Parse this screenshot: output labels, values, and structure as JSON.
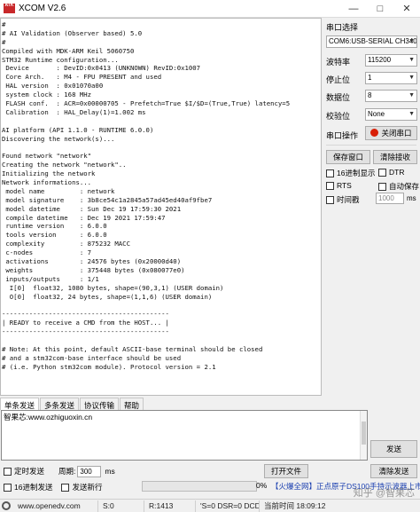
{
  "window": {
    "title": "XCOM V2.6",
    "app_icon_text": "ATK\nXCOM"
  },
  "terminal": {
    "lines": [
      "#",
      "# AI Validation (Observer based) 5.0",
      "#",
      "Compiled with MDK-ARM Keil 5060750",
      "STM32 Runtime configuration...",
      " Device       : DevID:0x0413 (UNKNOWN) RevID:0x1007",
      " Core Arch.   : M4 - FPU PRESENT and used",
      " HAL version  : 0x01070a00",
      " system clock : 168 MHz",
      " FLASH conf.  : ACR=0x00000705 - Prefetch=True $I/$D=(True,True) latency=5",
      " Calibration  : HAL_Delay(1)=1.002 ms",
      "",
      "AI platform (API 1.1.0 - RUNTIME 6.0.0)",
      "Discovering the network(s)...",
      "",
      "Found network \"network\"",
      "Creating the network \"network\"..",
      "Initializing the network",
      "Network informations...",
      " model name         : network",
      " model signature    : 3b8ce54c1a2845a57ad45ed40af9fbe7",
      " model datetime     : Sun Dec 19 17:59:30 2021",
      " compile datetime   : Dec 19 2021 17:59:47",
      " runtime version    : 6.0.0",
      " tools version      : 6.0.0",
      " complexity         : 875232 MACC",
      " c-nodes            : 7",
      " activations        : 24576 bytes (0x20000d40)",
      " weights            : 375448 bytes (0x080077e0)",
      " inputs/outputs     : 1/1",
      "  I[0]  float32, 1080 bytes, shape=(90,3,1) (USER domain)",
      "  O[0]  float32, 24 bytes, shape=(1,1,6) (USER domain)",
      "",
      "-------------------------------------------",
      "| READY to receive a CMD from the HOST... |",
      "-------------------------------------------",
      "",
      "# Note: At this point, default ASCII-base terminal should be closed",
      "# and a stm32com-base interface should be used",
      "# (i.e. Python stm32com module). Protocol version = 2.1"
    ]
  },
  "panel": {
    "port_select_heading": "串口选择",
    "port_value": "COM6:USB-SERIAL CH340",
    "baud_label": "波特率",
    "baud_value": "115200",
    "stopbits_label": "停止位",
    "stopbits_value": "1",
    "databits_label": "数据位",
    "databits_value": "8",
    "parity_label": "校验位",
    "parity_value": "None",
    "port_op_label": "串口操作",
    "close_port_label": "关闭串口",
    "save_window_label": "保存窗口",
    "clear_receive_label": "清除接收",
    "hex_display_label": "16进制显示",
    "dtr_label": "DTR",
    "rts_label": "RTS",
    "auto_save_label": "自动保存",
    "timestamp_label": "时间戳",
    "timestamp_value": "1000",
    "timestamp_unit": "ms"
  },
  "bottom": {
    "tabs": [
      "单条发送",
      "多条发送",
      "协议传输",
      "帮助"
    ],
    "send_text": "智果芯:www.ozhiguoxin.cn",
    "send_button": "发送",
    "clear_send_button": "清除发送",
    "timed_send_label": "定时发送",
    "period_label": "周期:",
    "period_value": "300",
    "period_unit": "ms",
    "open_file_button": "打开文件",
    "send_file_button": "发送文件",
    "stop_send_button": "停止发送",
    "hex_send_label": "16进制发送",
    "send_newline_label": "发送新行",
    "progress_percent": "0%",
    "ad_text": "【火爆全网】正点原子DS100手持示波器上市"
  },
  "statusbar": {
    "website": "www.openedv.com",
    "s_count": "S:0",
    "r_count": "R:1413",
    "signals": "'S=0 DSR=0 DCD=",
    "time": "当前时间 18:09:12"
  },
  "watermark": "知乎 @智果芯"
}
